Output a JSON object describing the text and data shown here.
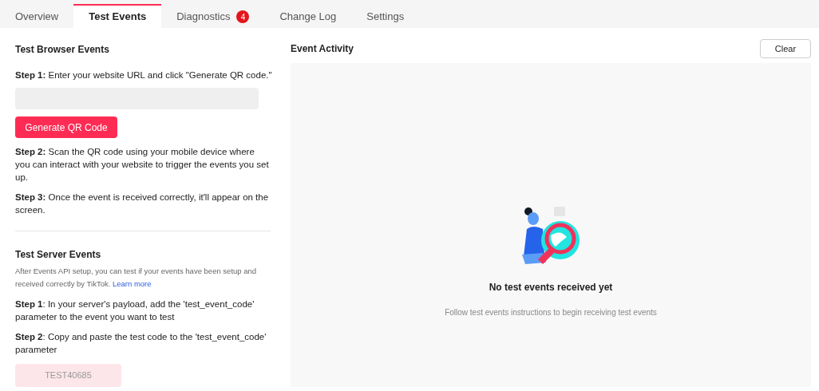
{
  "tabs": [
    {
      "label": "Overview",
      "selected": false
    },
    {
      "label": "Test Events",
      "selected": true
    },
    {
      "label": "Diagnostics",
      "selected": false,
      "badge": "4"
    },
    {
      "label": "Change Log",
      "selected": false
    },
    {
      "label": "Settings",
      "selected": false
    }
  ],
  "browser": {
    "title": "Test Browser Events",
    "step1": "**Step 1:** Enter your website URL and click \"Generate QR code.\"",
    "button": "Generate QR Code",
    "steps": [
      "**Step 2:** Scan the QR code using your mobile device where you can interact with your website to trigger the events you set up.",
      "**Step 3:** Once the event is received correctly, it'll appear on the screen."
    ]
  },
  "server": {
    "title": "Test Server Events",
    "description": "After Events API setup, you can test if your events have been setup and received correctly by TikTok.",
    "link": "Learn more",
    "steps": [
      "**Step 1**: In your server's payload, add the 'test_event_code' parameter to the event you want to test",
      "**Step 2**: Copy and paste the test code to the 'test_event_code' parameter"
    ],
    "test_code": "TEST40685"
  },
  "activity": {
    "title": "Event Activity",
    "clear_button": "Clear",
    "empty_title": "No test events received yet",
    "empty_hint": "Follow test events instructions to begin receiving test events"
  }
}
